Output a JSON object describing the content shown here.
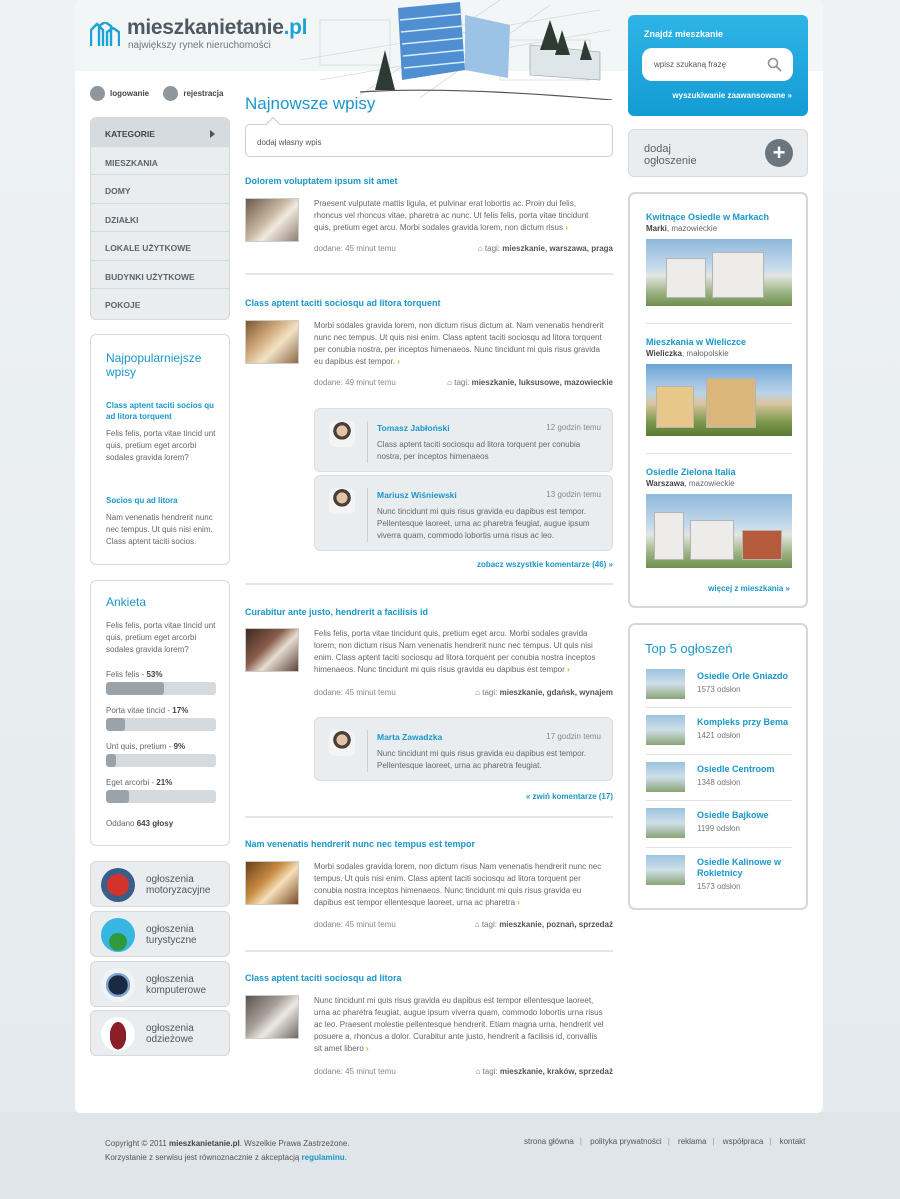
{
  "header": {
    "logo_main": "mieszkanietanie",
    "logo_ext": ".pl",
    "tagline": "największy rynek nieruchomości"
  },
  "search": {
    "title": "Znajdź mieszkanie",
    "placeholder": "wpisz szukaną frazę",
    "advanced": "wyszukiwanie zaawansowane »"
  },
  "add_listing": {
    "line1": "dodaj",
    "line2": "ogłoszenie"
  },
  "auth": {
    "login": "logowanie",
    "register": "rejestracja"
  },
  "nav": [
    "KATEGORIE",
    "MIESZKANIA",
    "DOMY",
    "DZIAŁKI",
    "LOKALE UŻYTKOWE",
    "BUDYNKI UŻYTKOWE",
    "POKOJE"
  ],
  "popular": {
    "title": "Najpopularniejsze wpisy",
    "items": [
      {
        "title": "Class aptent taciti socios qu ad litora torquent",
        "body": "Felis felis, porta vitae tincid unt quis, pretium eget arcorbi sodales gravida lorem?"
      },
      {
        "title": "Socios qu ad litora",
        "body": "Nam venenatis hendrerit nunc nec tempus. Ut quis nisi enim. Class aptent taciti socios."
      }
    ]
  },
  "poll": {
    "title": "Ankieta",
    "question": "Felis felis, porta vitae tincid unt quis, pretium eget arcorbi sodales gravida lorem?",
    "options": [
      {
        "label": "Felis felis",
        "pct": "53%",
        "value": 0.53
      },
      {
        "label": "Porta vitae tincid",
        "pct": "17%",
        "value": 0.17
      },
      {
        "label": "Unt quis, pretium",
        "pct": "9%",
        "value": 0.09
      },
      {
        "label": "Eget arcorbi",
        "pct": "21%",
        "value": 0.21
      }
    ],
    "votes_prefix": "Oddano",
    "votes": "643 głosy"
  },
  "categories": [
    {
      "line1": "ogłoszenia",
      "line2": "motoryzacyjne",
      "icon": "car-icon"
    },
    {
      "line1": "ogłoszenia",
      "line2": "turystyczne",
      "icon": "palm-icon"
    },
    {
      "line1": "ogłoszenia",
      "line2": "komputerowe",
      "icon": "computer-icon"
    },
    {
      "line1": "ogłoszenia",
      "line2": "odzieżowe",
      "icon": "clothing-icon"
    }
  ],
  "main": {
    "title": "Najnowsze wpisy",
    "post_placeholder": "dodaj własny wpis"
  },
  "posts": [
    {
      "title": "Dolorem voluptatem ipsum sit amet",
      "body": "Praesent vulputate mattis ligula, et pulvinar erat lobortis ac. Proin dui felis, rhoncus vel rhoncus vitae, pharetra ac nunc. Ut felis felis, porta vitae tincidunt quis, pretium eget arcu. Morbi sodales gravida lorem, non dictum risus",
      "added": "dodane: 45 minut temu",
      "tags_label": "tagi:",
      "tags": "mieszkanie, warszawa, praga"
    },
    {
      "title": "Class aptent taciti sociosqu ad litora torquent",
      "body": "Morbi sodales gravida lorem, non dictum risus dictum at. Nam venenatis hendrerit nunc nec tempus. Ut quis nisi enim. Class aptent taciti sociosqu ad litora torquent per conubia nostra, per inceptos himenaeos. Nunc tincidunt mi quis risus gravida eu dapibus est tempor.",
      "added": "dodane: 49 minut temu",
      "tags_label": "tagi:",
      "tags": "mieszkanie, luksusowe, mazowieckie"
    },
    {
      "title": "Curabitur ante justo, hendrerit a facilisis id",
      "body": "Felis felis, porta vitae tincidunt quis, pretium eget arcu. Morbi sodales gravida lorem, non dictum risus Nam venenatis hendrerit nunc nec tempus. Ut quis nisi enim. Class aptent taciti sociosqu ad litora torquent per conubia nostra inceptos himenaeos. Nunc tincidunt mi quis risus gravida eu dapibus est tempor",
      "added": "dodane: 45 minut temu",
      "tags_label": "tagi:",
      "tags": "mieszkanie, gdańsk, wynajem"
    },
    {
      "title": "Nam venenatis hendrerit nunc nec tempus est tempor",
      "body": "Morbi sodales gravida lorem, non dictum risus Nam venenatis hendrerit nunc nec tempus. Ut quis nisi enim. Class aptent taciti sociosqu ad litora torquent per conubia nostra inceptos himenaeos. Nunc tincidunt mi quis risus gravida eu dapibus est tempor ellentesque laoreet, urna ac pharetra",
      "added": "dodane: 45 minut temu",
      "tags_label": "tagi:",
      "tags": "mieszkanie, poznań, sprzedaż"
    },
    {
      "title": "Class aptent taciti sociosqu ad litora",
      "body": "Nunc tincidunt mi quis risus gravida eu dapibus est tempor ellentesque laoreet, urna ac pharetra feugiat, augue ipsum viverra quam, commodo lobortis urna risus ac leo. Praesent molestie pellentesque hendrerit. Etiam magna urna, hendrerit vel posuere a, rhoncus a dolor. Curabitur ante justo, hendrerit a facilisis id, convallis sit amet libero",
      "added": "dodane: 45 minut temu",
      "tags_label": "tagi:",
      "tags": "mieszkanie, kraków, sprzedaż"
    }
  ],
  "comments": [
    {
      "name": "Tomasz Jabłoński",
      "time": "12 godzin temu",
      "body": "Class aptent taciti sociosqu ad litora torquent per conubia nostra, per inceptos himenaeos"
    },
    {
      "name": "Mariusz Wiśniewski",
      "time": "13 godzin temu",
      "body": "Nunc tincidunt mi quis risus gravida eu dapibus est tempor. Pellentesque laoreet, urna ac pharetra feugiat, augue ipsum viverra quam, commodo lobortis urna risus ac leo."
    },
    {
      "name": "Marta Zawadzka",
      "time": "17 godzin temu",
      "body": "Nunc tincidunt mi quis risus gravida eu dapibus est tempor. Pellentesque laoreet, urna ac pharetra feugiat."
    }
  ],
  "comment_links": {
    "show_all": "zobacz wszystkie komentarze (46) »",
    "collapse": "« zwiń komentarze (17)"
  },
  "investments": {
    "items": [
      {
        "name": "Kwitnące Osiedle w Markach",
        "city": "Marki",
        "region": ", mazowieckie"
      },
      {
        "name": "Mieszkania w Wieliczce",
        "city": "Wieliczka",
        "region": ", małopolskie"
      },
      {
        "name": "Osiedle Zielona Italia",
        "city": "Warszawa",
        "region": ", mazowieckie"
      }
    ],
    "more": "więcej z mieszkania »"
  },
  "top5": {
    "title": "Top 5 ogłoszeń",
    "items": [
      {
        "name": "Osiedle Orle Gniazdo",
        "views": "1573 odsłon"
      },
      {
        "name": "Kompleks przy Bema",
        "views": "1421 odsłon"
      },
      {
        "name": "Osiedle Centroom",
        "views": "1348 odsłon"
      },
      {
        "name": "Osiedle Bajkowe",
        "views": "1199 odsłon"
      },
      {
        "name": "Osiedle Kalinowe w Rokietnicy",
        "views": "1573 odsłon"
      }
    ]
  },
  "footer": {
    "copy_pre": "Copyright © 2011",
    "site": "mieszkanietanie.pl",
    "copy_post": ". Wszelkie Prawa Zastrzeżone.",
    "terms_pre": "Korzystanie z serwisu jest równoznacznie z akceptacją",
    "terms_link": "regulaminu",
    "terms_post": ".",
    "links": [
      "strona główna",
      "polityka prywatności",
      "reklama",
      "współpraca",
      "kontakt"
    ]
  }
}
